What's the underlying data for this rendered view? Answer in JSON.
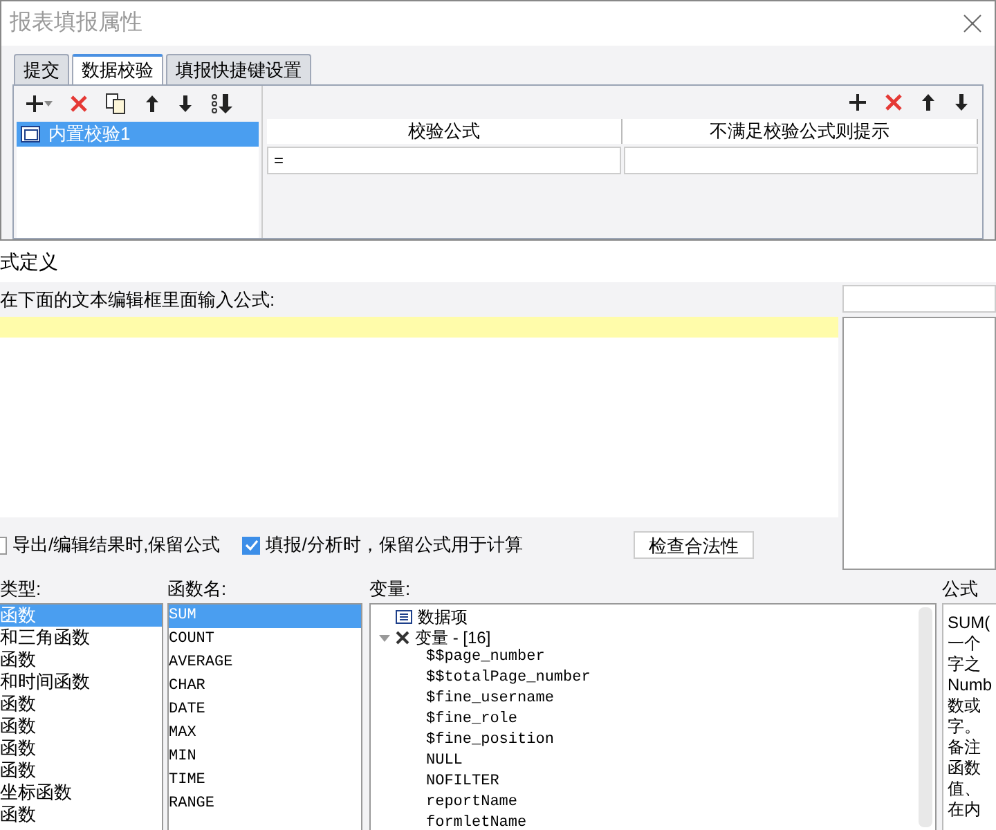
{
  "back_dialog": {
    "title": "报表填报属性",
    "tabs": [
      {
        "label": "提交",
        "selected": false
      },
      {
        "label": "数据校验",
        "selected": true
      },
      {
        "label": "填报快捷键设置",
        "selected": false
      }
    ],
    "checks": [
      {
        "label": "内置校验1",
        "selected": true
      }
    ],
    "table": {
      "columns": [
        "校验公式",
        "不满足校验公式则提示"
      ],
      "rows": [
        [
          "=",
          ""
        ]
      ]
    }
  },
  "formula_dialog": {
    "title": "式定义",
    "prompt": "在下面的文本编辑框里面输入公式:",
    "options": [
      {
        "label": "导出/编辑结果时,保留公式",
        "checked": false
      },
      {
        "label": "填报/分析时，保留公式用于计算",
        "checked": true
      }
    ],
    "check_button": "检查合法性",
    "type_label": "类型:",
    "function_label": "函数名:",
    "variable_label": "变量:",
    "description_label": "公式",
    "types": [
      {
        "label": "函数",
        "selected": true
      },
      {
        "label": "和三角函数",
        "selected": false
      },
      {
        "label": "函数",
        "selected": false
      },
      {
        "label": "和时间函数",
        "selected": false
      },
      {
        "label": "函数",
        "selected": false
      },
      {
        "label": "函数",
        "selected": false
      },
      {
        "label": "函数",
        "selected": false
      },
      {
        "label": "函数",
        "selected": false
      },
      {
        "label": "坐标函数",
        "selected": false
      },
      {
        "label": "函数",
        "selected": false
      }
    ],
    "functions": [
      {
        "label": "SUM",
        "selected": true
      },
      {
        "label": "COUNT",
        "selected": false
      },
      {
        "label": "AVERAGE",
        "selected": false
      },
      {
        "label": "CHAR",
        "selected": false
      },
      {
        "label": "DATE",
        "selected": false
      },
      {
        "label": "MAX",
        "selected": false
      },
      {
        "label": "MIN",
        "selected": false
      },
      {
        "label": "TIME",
        "selected": false
      },
      {
        "label": "RANGE",
        "selected": false
      }
    ],
    "variables": [
      {
        "label": "数据项",
        "kind": "data"
      },
      {
        "label": "变量 - [16]",
        "kind": "group",
        "expanded": true,
        "children": [
          {
            "label": "$$page_number"
          },
          {
            "label": "$$totalPage_number"
          },
          {
            "label": "$fine_username"
          },
          {
            "label": "$fine_role"
          },
          {
            "label": "$fine_position"
          },
          {
            "label": "NULL"
          },
          {
            "label": "NOFILTER"
          },
          {
            "label": "reportName"
          },
          {
            "label": "formletName"
          }
        ]
      }
    ],
    "description": [
      "SUM(",
      "一个",
      "字之",
      "Numb",
      "数或",
      "字。",
      "备注",
      "函数",
      "值、",
      "在内"
    ]
  }
}
